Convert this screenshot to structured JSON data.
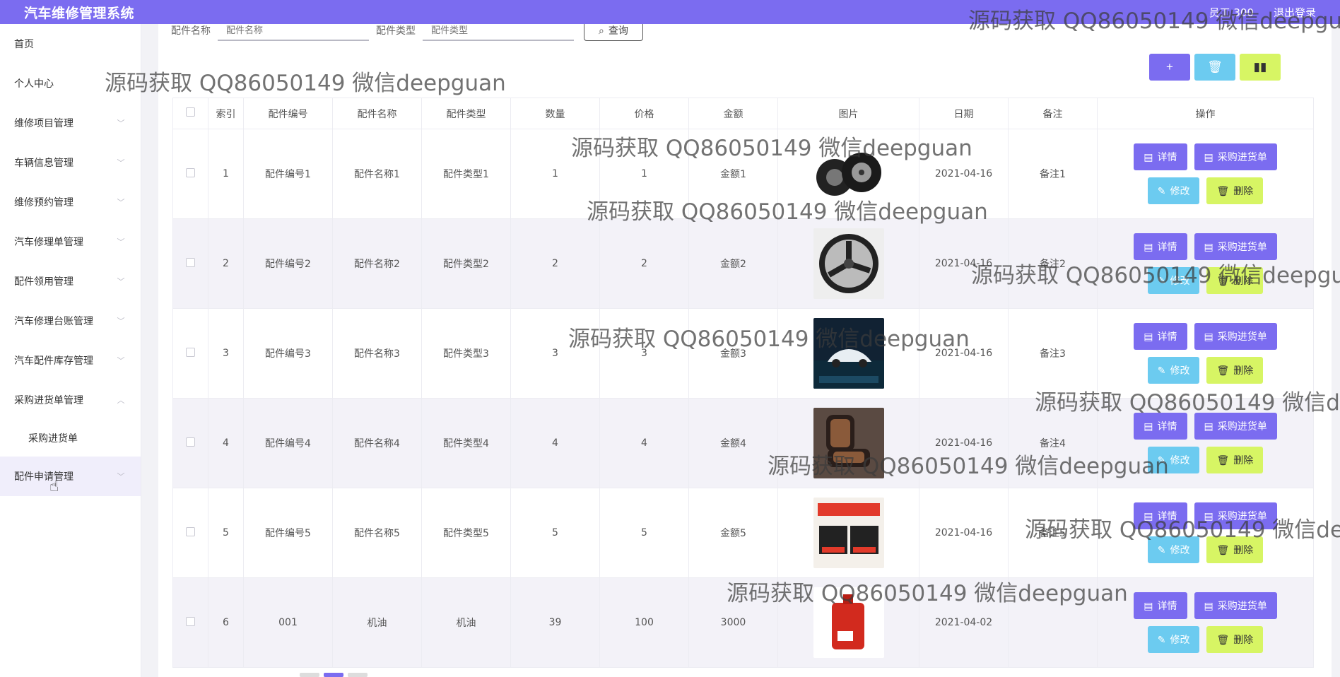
{
  "app": {
    "title": "汽车维修管理系统",
    "user_label": "员工 300",
    "logout_label": "退出登录"
  },
  "sidebar": {
    "items": [
      {
        "label": "首页",
        "chevron": ""
      },
      {
        "label": "个人中心",
        "chevron": ""
      },
      {
        "label": "维修项目管理",
        "chevron": "﹀"
      },
      {
        "label": "车辆信息管理",
        "chevron": "﹀"
      },
      {
        "label": "维修预约管理",
        "chevron": "﹀"
      },
      {
        "label": "汽车修理单管理",
        "chevron": "﹀"
      },
      {
        "label": "配件领用管理",
        "chevron": "﹀"
      },
      {
        "label": "汽车修理台账管理",
        "chevron": "﹀"
      },
      {
        "label": "汽车配件库存管理",
        "chevron": "﹀"
      },
      {
        "label": "采购进货单管理",
        "chevron": "︿"
      },
      {
        "label": "采购进货单",
        "chevron": ""
      },
      {
        "label": "配件申请管理",
        "chevron": "﹀"
      }
    ]
  },
  "search": {
    "name_label": "配件名称",
    "name_placeholder": "配件名称",
    "type_label": "配件类型",
    "type_placeholder": "配件类型",
    "query_label": "查询"
  },
  "toolbar": {
    "add_icon": "+",
    "delete_icon": "🗑",
    "chart_icon": "▮▮"
  },
  "table": {
    "headers": [
      "索引",
      "配件编号",
      "配件名称",
      "配件类型",
      "数量",
      "价格",
      "金额",
      "图片",
      "日期",
      "备注",
      "操作"
    ],
    "rows": [
      {
        "index": "1",
        "code": "配件编号1",
        "name": "配件名称1",
        "type": "配件类型1",
        "qty": "1",
        "price": "1",
        "amount": "金额1",
        "image": "tires",
        "date": "2021-04-16",
        "note": "备注1"
      },
      {
        "index": "2",
        "code": "配件编号2",
        "name": "配件名称2",
        "type": "配件类型2",
        "qty": "2",
        "price": "2",
        "amount": "金额2",
        "image": "rim",
        "date": "2021-04-16",
        "note": "备注2"
      },
      {
        "index": "3",
        "code": "配件编号3",
        "name": "配件名称3",
        "type": "配件类型3",
        "qty": "3",
        "price": "3",
        "amount": "金额3",
        "image": "car-ad",
        "date": "2021-04-16",
        "note": "备注3"
      },
      {
        "index": "4",
        "code": "配件编号4",
        "name": "配件名称4",
        "type": "配件类型4",
        "qty": "4",
        "price": "4",
        "amount": "金额4",
        "image": "seat",
        "date": "2021-04-16",
        "note": "备注4"
      },
      {
        "index": "5",
        "code": "配件编号5",
        "name": "配件名称5",
        "type": "配件类型5",
        "qty": "5",
        "price": "5",
        "amount": "金额5",
        "image": "product-box",
        "date": "2021-04-16",
        "note": "备注5"
      },
      {
        "index": "6",
        "code": "001",
        "name": "机油",
        "type": "机油",
        "qty": "39",
        "price": "100",
        "amount": "3000",
        "image": "oil-can",
        "date": "2021-04-02",
        "note": ""
      }
    ],
    "actions": {
      "detail": "详情",
      "purchase": "采购进货单",
      "edit": "修改",
      "delete": "删除"
    }
  },
  "watermark_text": "源码获取 QQ86050149 微信deepguan",
  "colors": {
    "primary": "#7b6cf0",
    "info": "#6ccbf0",
    "warning": "#d7f564"
  }
}
